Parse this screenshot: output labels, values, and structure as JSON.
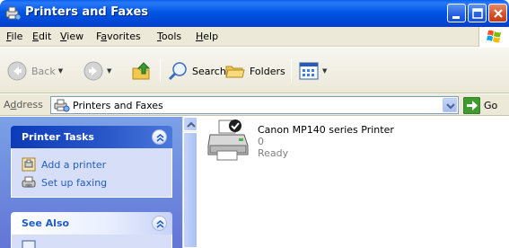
{
  "window": {
    "title": "Printers and Faxes"
  },
  "menu": [
    {
      "pre": "",
      "key": "F",
      "post": "ile"
    },
    {
      "pre": "",
      "key": "E",
      "post": "dit"
    },
    {
      "pre": "",
      "key": "V",
      "post": "iew"
    },
    {
      "pre": "F",
      "key": "a",
      "post": "vorites"
    },
    {
      "pre": "",
      "key": "T",
      "post": "ools"
    },
    {
      "pre": "",
      "key": "H",
      "post": "elp"
    }
  ],
  "toolbar": {
    "back": "Back",
    "search": "Search",
    "folders": "Folders"
  },
  "address": {
    "label_key": "d",
    "label_pre": "A",
    "label_post": "dress",
    "value": "Printers and Faxes",
    "go": "Go"
  },
  "task_pane": {
    "printer_tasks": {
      "title": "Printer Tasks",
      "links": [
        "Add a printer",
        "Set up faxing"
      ]
    },
    "see_also": {
      "title": "See Also"
    }
  },
  "printers": [
    {
      "name": "Canon MP140 series Printer",
      "documents": "0",
      "status": "Ready",
      "is_default": true
    }
  ],
  "colors": {
    "titlebar": "#0055e5",
    "taskpane": "#6375d6",
    "link": "#215dc6"
  }
}
